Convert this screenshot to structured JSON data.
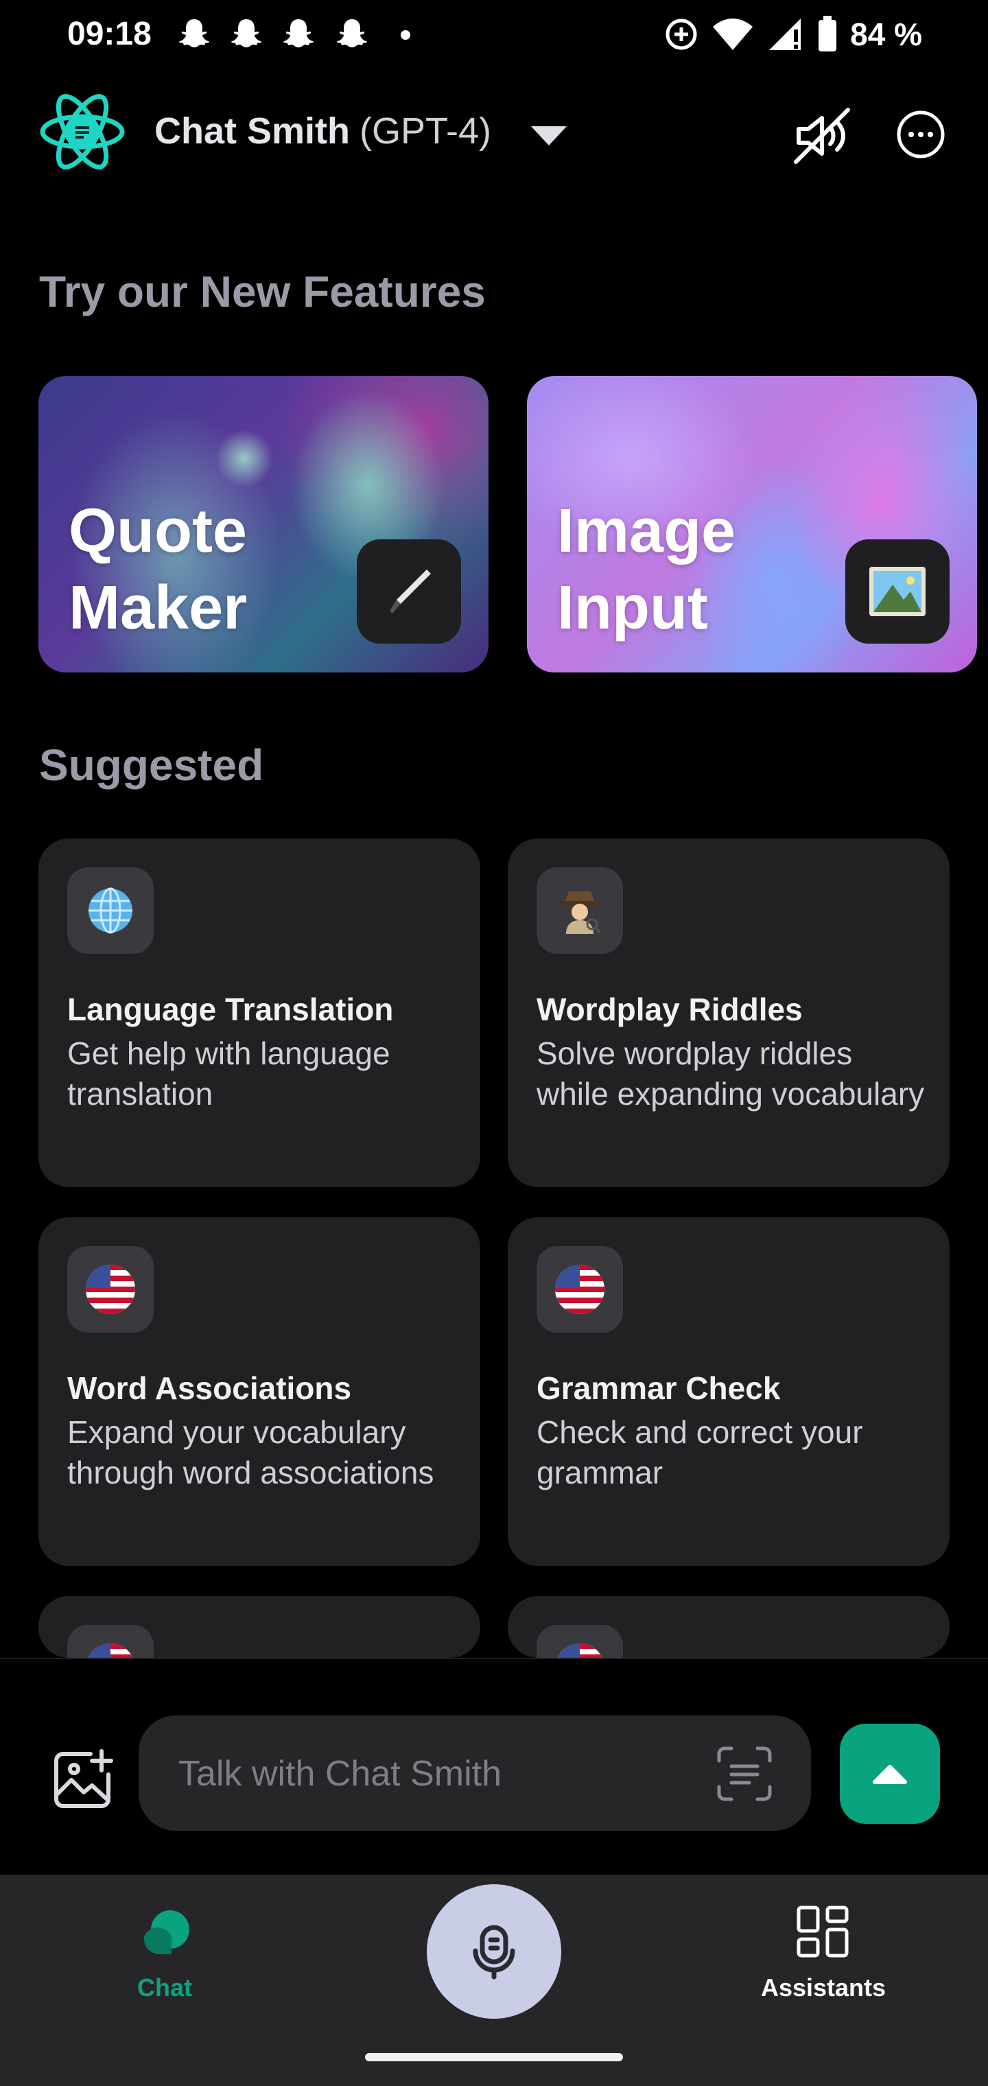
{
  "status_bar": {
    "time": "09:18",
    "battery": "84 %",
    "icons": [
      "snapchat-icon",
      "snapchat-icon",
      "snapchat-icon",
      "snapchat-icon",
      "dot-icon",
      "data-saver-icon",
      "wifi-icon",
      "cellular-icon",
      "battery-icon"
    ]
  },
  "header": {
    "app_name": "Chat Smith",
    "model": "(GPT-4)",
    "icons": [
      "atom-logo-icon",
      "chevron-down-icon",
      "volume-off-icon",
      "more-icon"
    ]
  },
  "features": {
    "title": "Try our New Features",
    "cards": [
      {
        "label_line1": "Quote",
        "label_line2": "Maker",
        "icon": "pen-icon"
      },
      {
        "label_line1": "Image",
        "label_line2": "Input",
        "icon": "landscape-icon"
      }
    ]
  },
  "suggested": {
    "title": "Suggested",
    "items": [
      {
        "title": "Language Translation",
        "description": "Get help with language translation",
        "icon": "globe-icon"
      },
      {
        "title": "Wordplay Riddles",
        "description": "Solve wordplay riddles while expanding vocabulary",
        "icon": "detective-icon"
      },
      {
        "title": "Word Associations",
        "description": "Expand your vocabulary through word associations",
        "icon": "us-flag-icon"
      },
      {
        "title": "Grammar Check",
        "description": "Check and correct your grammar",
        "icon": "us-flag-icon"
      }
    ]
  },
  "composer": {
    "placeholder": "Talk with Chat Smith",
    "icons": [
      "image-add-icon",
      "scan-text-icon",
      "send-arrow-icon"
    ]
  },
  "bottom_nav": {
    "chat_label": "Chat",
    "assistants_label": "Assistants",
    "icons": [
      "chat-bubble-icon",
      "microphone-icon",
      "grid-icon"
    ]
  },
  "colors": {
    "accent_green": "#0aa37f",
    "card_bg": "#212124",
    "nav_bg": "#262629",
    "logo_teal": "#1fd6c4",
    "mic_bg": "#c9cde6"
  }
}
